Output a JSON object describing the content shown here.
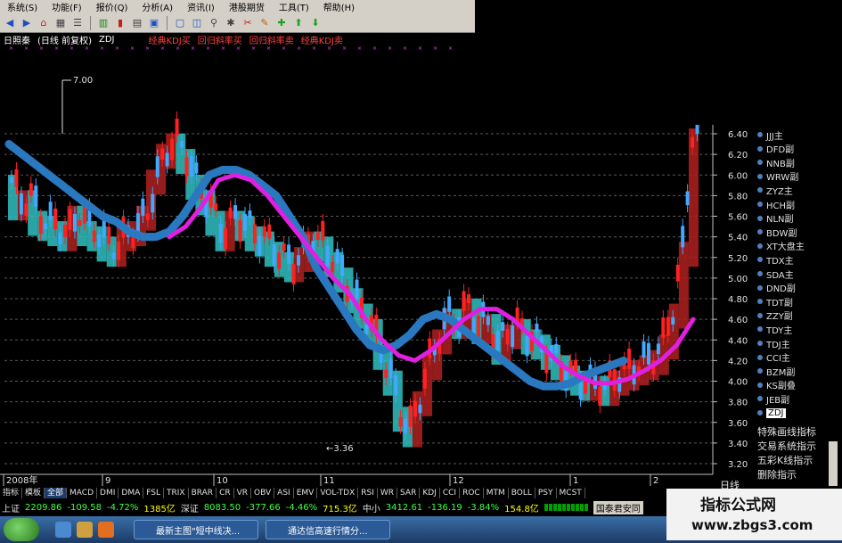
{
  "menu": [
    "系统(S)",
    "功能(F)",
    "报价(Q)",
    "分析(A)",
    "资讯(I)",
    "港股期货",
    "工具(T)",
    "帮助(H)"
  ],
  "chart_title": {
    "period": "日照秦",
    "mode": "(日线 前复权)",
    "indicator": "ZDJ"
  },
  "signals": [
    "经典KDJ买",
    "回归斜率买",
    "回归斜率卖",
    "经典KDJ卖"
  ],
  "annotations": {
    "high": "7.00",
    "low": "←3.36"
  },
  "price_axis": [
    "6.40",
    "6.20",
    "6.00",
    "5.80",
    "5.60",
    "5.40",
    "5.20",
    "5.00",
    "4.80",
    "4.60",
    "4.40",
    "4.20",
    "4.00",
    "3.80",
    "3.60",
    "3.40",
    "3.20"
  ],
  "date_axis": [
    {
      "label": "2008年"
    },
    {
      "label": "9"
    },
    {
      "label": "10"
    },
    {
      "label": "11"
    },
    {
      "label": "12"
    },
    {
      "label": "1"
    },
    {
      "label": "2"
    }
  ],
  "right_label": "日线",
  "indicators": [
    "JJJ主",
    "DFD副",
    "NNB副",
    "WRW副",
    "ZYZ主",
    "HCH副",
    "NLN副",
    "BDW副",
    "XT大盘主",
    "TDX主",
    "SDA主",
    "DND副",
    "TDT副",
    "ZZY副",
    "TDY主",
    "TDJ主",
    "CCI主",
    "BZM副",
    "KS副叠",
    "JEB副",
    "ZDJ"
  ],
  "panel_texts": [
    "特殊画线指标",
    "交易系统指示",
    "五彩K线指示",
    "删除指示"
  ],
  "tabs": [
    "指标",
    "模板",
    "全部",
    "MACD",
    "DMI",
    "DMA",
    "FSL",
    "TRIX",
    "BRAR",
    "CR",
    "VR",
    "OBV",
    "ASI",
    "EMV",
    "VOL-TDX",
    "RSI",
    "WR",
    "SAR",
    "KDJ",
    "CCI",
    "ROC",
    "MTM",
    "BOLL",
    "PSY",
    "MCST"
  ],
  "status": {
    "sh_label": "上证",
    "sh_value": "2209.86",
    "sh_change": "-109.58",
    "sh_pct": "-4.72%",
    "sh_amount": "1385亿",
    "sz_label": "深证",
    "sz_value": "8083.50",
    "sz_change": "-377.66",
    "sz_pct": "-4.46%",
    "sz_amount": "715.3亿",
    "zx_label": "中小",
    "zx_value": "3412.61",
    "zx_change": "-136.19",
    "zx_pct": "-3.84%",
    "zx_amount": "154.8亿",
    "broker": "国泰君安同"
  },
  "taskbar": {
    "task1": "最新主图\"短中线决...",
    "task2": "通达信高速行情分..."
  },
  "watermark": {
    "line1": "指标公式网",
    "line2": "www.zbgs3.com"
  },
  "colors": {
    "up": "#ff2020",
    "down": "#40a8ff",
    "band_up": "#b02020",
    "band_down": "#30c0c0",
    "blue_ma": "#2a78c0",
    "magenta_ma": "#e020e0"
  },
  "chart_data": {
    "type": "candlestick",
    "ylim": [
      3.2,
      6.4
    ],
    "close_path": [
      5.95,
      5.75,
      5.8,
      5.6,
      5.55,
      5.5,
      5.45,
      5.65,
      5.5,
      5.45,
      5.35,
      5.3,
      5.45,
      5.5,
      5.65,
      6.0,
      6.25,
      6.35,
      6.2,
      5.95,
      5.8,
      5.6,
      5.45,
      5.6,
      5.55,
      5.45,
      5.4,
      5.3,
      5.2,
      5.15,
      5.25,
      5.4,
      5.35,
      5.2,
      5.05,
      4.85,
      4.7,
      4.55,
      4.3,
      4.05,
      3.7,
      3.55,
      3.85,
      4.2,
      4.45,
      4.65,
      4.6,
      4.75,
      4.55,
      4.6,
      4.35,
      4.5,
      4.55,
      4.45,
      4.4,
      4.3,
      4.2,
      4.1,
      4.05,
      4.0,
      4.0,
      3.95,
      4.05,
      4.1,
      4.15,
      4.2,
      4.25,
      4.4,
      4.7,
      5.3,
      6.4
    ],
    "blue_ma": [
      6.3,
      6.2,
      6.1,
      6.0,
      5.9,
      5.8,
      5.7,
      5.6,
      5.55,
      5.45,
      5.4,
      5.4,
      5.45,
      5.6,
      5.8,
      6.0,
      6.05,
      6.05,
      6.0,
      5.9,
      5.8,
      5.6,
      5.4,
      5.1,
      4.9,
      4.7,
      4.5,
      4.35,
      4.3,
      4.35,
      4.45,
      4.6,
      4.65,
      4.6,
      4.5,
      4.4,
      4.3,
      4.2,
      4.1,
      4.0,
      3.95,
      3.95,
      3.98,
      4.05,
      4.1,
      4.15,
      4.2
    ],
    "magenta_ma": [
      5.4,
      5.5,
      5.7,
      5.95,
      6.0,
      5.95,
      5.8,
      5.6,
      5.4,
      5.2,
      5.0,
      4.85,
      4.6,
      4.4,
      4.25,
      4.2,
      4.3,
      4.45,
      4.6,
      4.7,
      4.7,
      4.6,
      4.45,
      4.3,
      4.15,
      4.05,
      3.98,
      3.98,
      4.02,
      4.1,
      4.2,
      4.35,
      4.6
    ]
  }
}
